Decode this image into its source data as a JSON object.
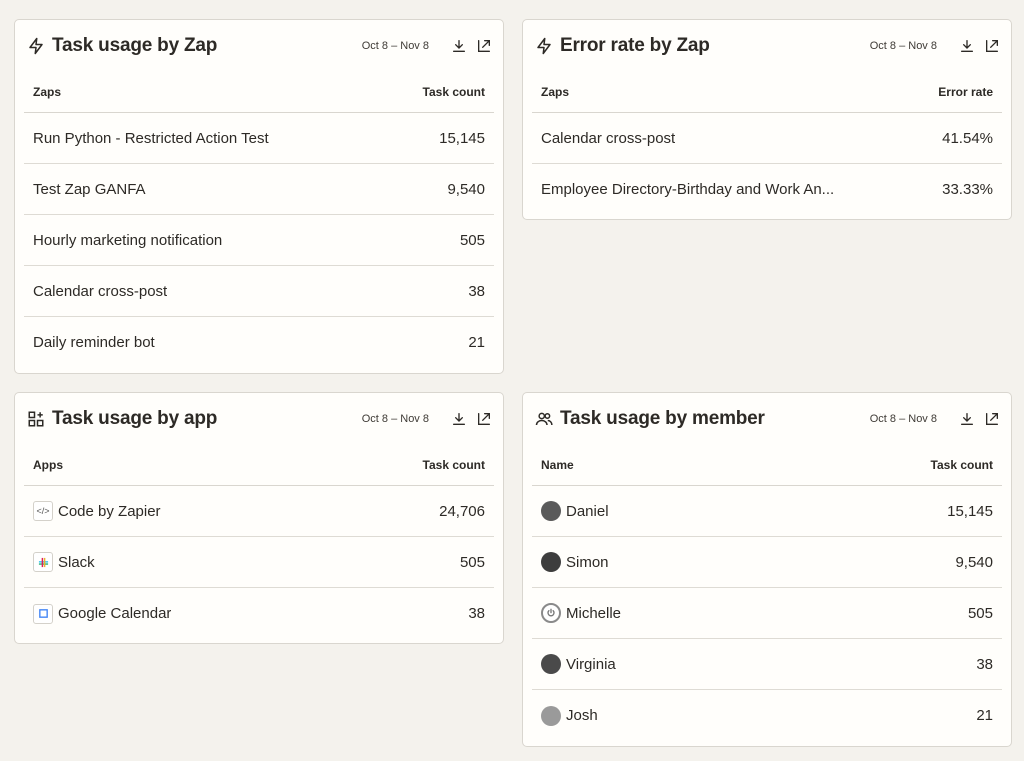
{
  "cards": {
    "zap_usage": {
      "title": "Task usage by Zap",
      "date_range": "Oct 8 – Nov 8",
      "col_name": "Zaps",
      "col_value": "Task count",
      "rows": [
        {
          "name": "Run Python - Restricted Action Test",
          "value": "15,145"
        },
        {
          "name": "Test Zap GANFA",
          "value": "9,540"
        },
        {
          "name": "Hourly marketing notification",
          "value": "505"
        },
        {
          "name": "Calendar cross-post",
          "value": "38"
        },
        {
          "name": "Daily reminder bot",
          "value": "21"
        }
      ]
    },
    "error_rate": {
      "title": "Error rate by Zap",
      "date_range": "Oct 8 – Nov 8",
      "col_name": "Zaps",
      "col_value": "Error rate",
      "rows": [
        {
          "name": "Calendar cross-post",
          "value": "41.54%"
        },
        {
          "name": "Employee Directory-Birthday and Work An...",
          "value": "33.33%"
        }
      ]
    },
    "app_usage": {
      "title": "Task usage by app",
      "date_range": "Oct 8 – Nov 8",
      "col_name": "Apps",
      "col_value": "Task count",
      "rows": [
        {
          "name": "Code by Zapier",
          "value": "24,706",
          "icon": "code-icon"
        },
        {
          "name": "Slack",
          "value": "505",
          "icon": "slack-icon"
        },
        {
          "name": "Google Calendar",
          "value": "38",
          "icon": "google-calendar-icon"
        }
      ]
    },
    "member_usage": {
      "title": "Task usage by member",
      "date_range": "Oct 8 – Nov 8",
      "col_name": "Name",
      "col_value": "Task count",
      "rows": [
        {
          "name": "Daniel",
          "value": "15,145"
        },
        {
          "name": "Simon",
          "value": "9,540"
        },
        {
          "name": "Michelle",
          "value": "505"
        },
        {
          "name": "Virginia",
          "value": "38"
        },
        {
          "name": "Josh",
          "value": "21"
        }
      ]
    }
  },
  "colors": {
    "background": "#f4f2ed",
    "card": "#fffefb",
    "border": "#d9d6cf",
    "text": "#2d2a26"
  }
}
